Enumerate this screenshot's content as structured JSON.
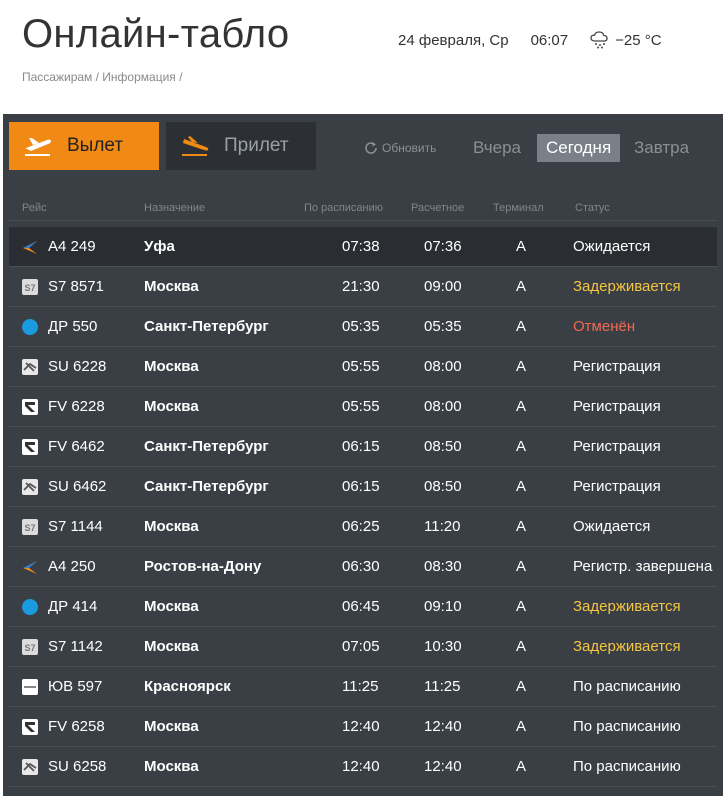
{
  "page": {
    "title": "Онлайн-табло",
    "date": "24 февраля, Ср",
    "time": "06:07",
    "temperature": "−25 °C",
    "breadcrumb": "Пассажирам / Информация /"
  },
  "tabs": {
    "departure": "Вылет",
    "arrival": "Прилет",
    "refresh": "Обновить",
    "yesterday": "Вчера",
    "today": "Сегодня",
    "tomorrow": "Завтра"
  },
  "columns": {
    "flight": "Рейс",
    "destination": "Назначение",
    "scheduled": "По расписанию",
    "estimated": "Расчетное",
    "terminal": "Терминал",
    "status": "Статус"
  },
  "colors": {
    "accent": "#f18a14",
    "board_bg": "#3a3f45",
    "delayed": "#f4c542",
    "cancelled": "#f06a50"
  },
  "flights": [
    {
      "airline_icon": "airline-a4-icon",
      "flight": "А4 249",
      "destination": "Уфа",
      "scheduled": "07:38",
      "estimated": "07:36",
      "terminal": "A",
      "status": "Ожидается",
      "status_type": "normal"
    },
    {
      "airline_icon": "airline-s7-icon",
      "flight": "S7 8571",
      "destination": "Москва",
      "scheduled": "21:30",
      "estimated": "09:00",
      "terminal": "A",
      "status": "Задерживается",
      "status_type": "delayed"
    },
    {
      "airline_icon": "airline-dp-icon",
      "flight": "ДР 550",
      "destination": "Санкт-Петербург",
      "scheduled": "05:35",
      "estimated": "05:35",
      "terminal": "A",
      "status": "Отменён",
      "status_type": "cancelled"
    },
    {
      "airline_icon": "airline-su-icon",
      "flight": "SU 6228",
      "destination": "Москва",
      "scheduled": "05:55",
      "estimated": "08:00",
      "terminal": "A",
      "status": "Регистрация",
      "status_type": "normal"
    },
    {
      "airline_icon": "airline-fv-icon",
      "flight": "FV 6228",
      "destination": "Москва",
      "scheduled": "05:55",
      "estimated": "08:00",
      "terminal": "A",
      "status": "Регистрация",
      "status_type": "normal"
    },
    {
      "airline_icon": "airline-fv-icon",
      "flight": "FV 6462",
      "destination": "Санкт-Петербург",
      "scheduled": "06:15",
      "estimated": "08:50",
      "terminal": "A",
      "status": "Регистрация",
      "status_type": "normal"
    },
    {
      "airline_icon": "airline-su-icon",
      "flight": "SU 6462",
      "destination": "Санкт-Петербург",
      "scheduled": "06:15",
      "estimated": "08:50",
      "terminal": "A",
      "status": "Регистрация",
      "status_type": "normal"
    },
    {
      "airline_icon": "airline-s7-icon",
      "flight": "S7 1144",
      "destination": "Москва",
      "scheduled": "06:25",
      "estimated": "11:20",
      "terminal": "A",
      "status": "Ожидается",
      "status_type": "normal"
    },
    {
      "airline_icon": "airline-a4-icon",
      "flight": "А4 250",
      "destination": "Ростов-на-Дону",
      "scheduled": "06:30",
      "estimated": "08:30",
      "terminal": "A",
      "status": "Регистр. завершена",
      "status_type": "normal"
    },
    {
      "airline_icon": "airline-dp-icon",
      "flight": "ДР 414",
      "destination": "Москва",
      "scheduled": "06:45",
      "estimated": "09:10",
      "terminal": "A",
      "status": "Задерживается",
      "status_type": "delayed"
    },
    {
      "airline_icon": "airline-s7-icon",
      "flight": "S7 1142",
      "destination": "Москва",
      "scheduled": "07:05",
      "estimated": "10:30",
      "terminal": "A",
      "status": "Задерживается",
      "status_type": "delayed"
    },
    {
      "airline_icon": "airline-yv-icon",
      "flight": "ЮВ 597",
      "destination": "Красноярск",
      "scheduled": "11:25",
      "estimated": "11:25",
      "terminal": "A",
      "status": "По расписанию",
      "status_type": "normal"
    },
    {
      "airline_icon": "airline-fv-icon",
      "flight": "FV 6258",
      "destination": "Москва",
      "scheduled": "12:40",
      "estimated": "12:40",
      "terminal": "A",
      "status": "По расписанию",
      "status_type": "normal"
    },
    {
      "airline_icon": "airline-su-icon",
      "flight": "SU 6258",
      "destination": "Москва",
      "scheduled": "12:40",
      "estimated": "12:40",
      "terminal": "A",
      "status": "По расписанию",
      "status_type": "normal"
    }
  ]
}
